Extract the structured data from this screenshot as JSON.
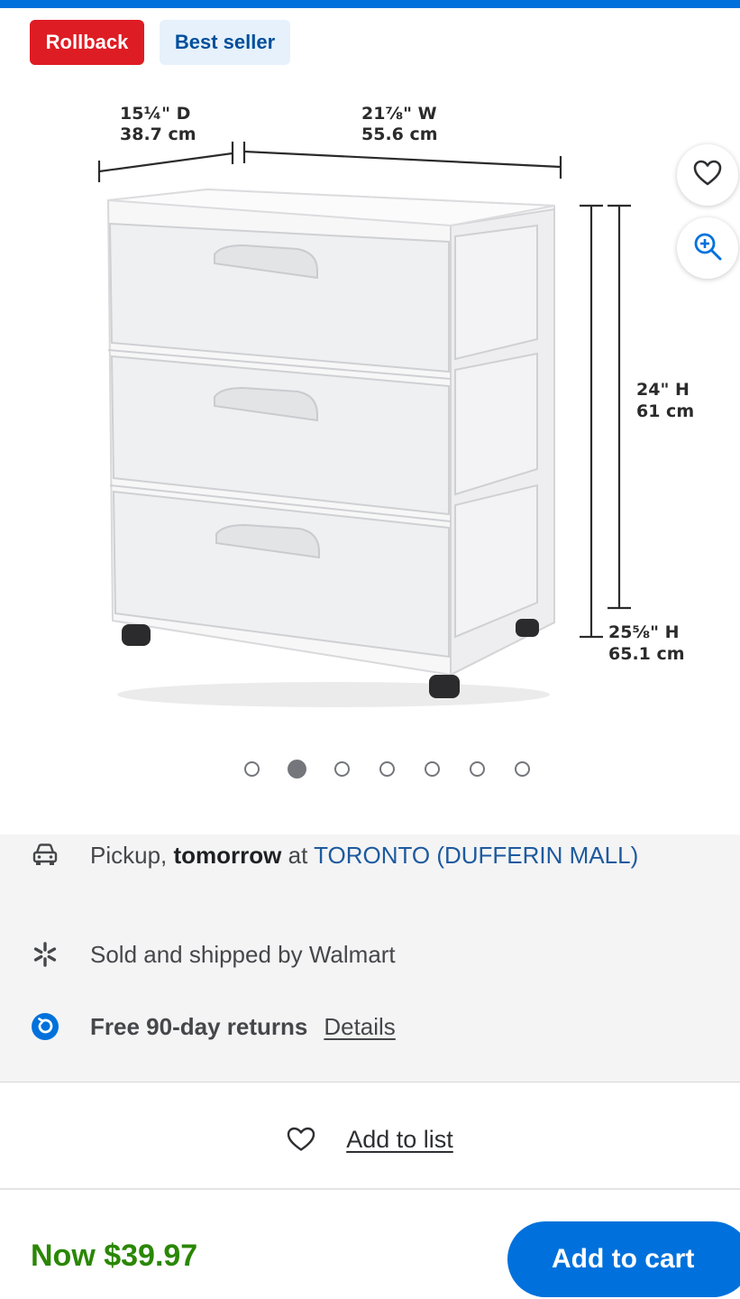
{
  "badges": {
    "rollback": "Rollback",
    "best_seller": "Best seller"
  },
  "dimensions": {
    "depth_in": "15¼\" D",
    "depth_cm": "38.7 cm",
    "width_in": "21⅞\" W",
    "width_cm": "55.6 cm",
    "height_in": "24\" H",
    "height_cm": "61 cm",
    "total_height_in": "25⅝\" H",
    "total_height_cm": "65.1 cm"
  },
  "carousel": {
    "count": 7,
    "active_index": 2
  },
  "actions": {
    "favorite_icon": "heart-icon",
    "zoom_icon": "zoom-in-icon"
  },
  "fulfillment": {
    "pickup_prefix": "Pickup, ",
    "pickup_when": "tomorrow",
    "pickup_at": " at ",
    "pickup_store": "TORONTO (DUFFERIN MALL)",
    "sold_by": "Sold and shipped by Walmart",
    "returns": "Free 90-day returns",
    "returns_link": "Details"
  },
  "add_to_list": "Add to list",
  "price": "Now $39.97",
  "add_to_cart": "Add to cart",
  "colors": {
    "accent": "#0071dc",
    "rollback": "#de1c24",
    "price": "#2a8703"
  }
}
